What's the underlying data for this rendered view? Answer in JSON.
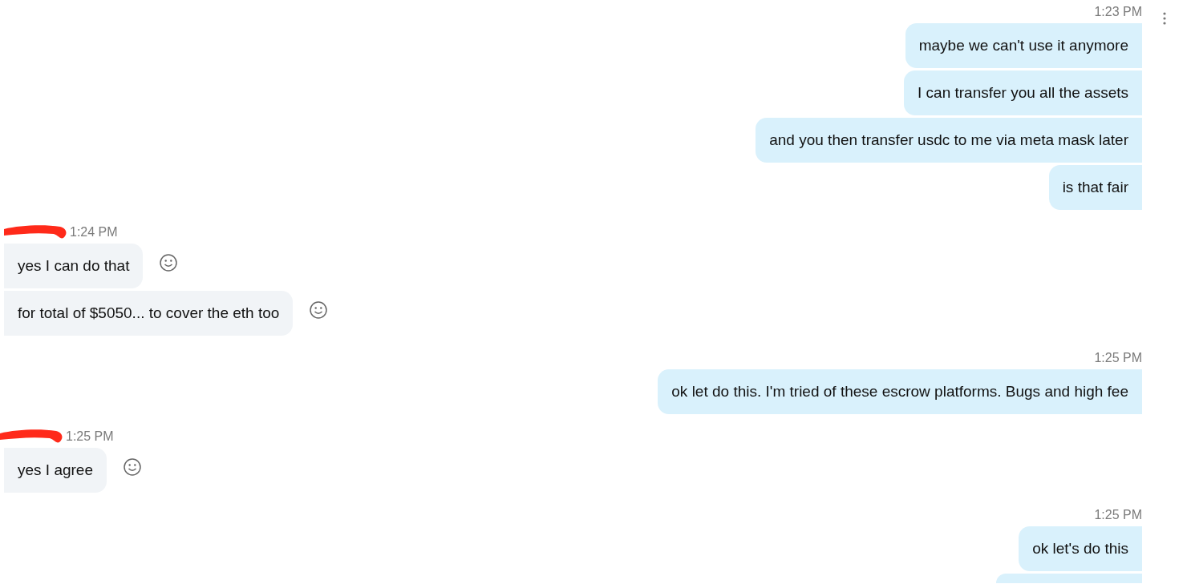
{
  "conversation": [
    {
      "kind": "sent",
      "time": "1:23 PM",
      "messages": [
        {
          "text": "maybe we can't use it anymore"
        },
        {
          "text": "I can transfer you all the assets"
        },
        {
          "text": "and you then transfer usdc to me via meta mask later"
        },
        {
          "text": "is that fair"
        }
      ]
    },
    {
      "kind": "received",
      "sender_redacted": true,
      "time": "1:24 PM",
      "messages": [
        {
          "text": "yes I can do that"
        },
        {
          "text": "for total of $5050... to cover the eth too"
        }
      ]
    },
    {
      "kind": "sent",
      "time": "1:25 PM",
      "messages": [
        {
          "text": "ok let do this. I'm tried of these escrow platforms. Bugs and high fee"
        }
      ]
    },
    {
      "kind": "received",
      "sender_redacted": true,
      "time": "1:25 PM",
      "messages": [
        {
          "text": "yes I agree"
        }
      ]
    },
    {
      "kind": "sent",
      "time": "1:25 PM",
      "messages": [
        {
          "text": "ok let's do this"
        }
      ],
      "more_below": true
    }
  ]
}
